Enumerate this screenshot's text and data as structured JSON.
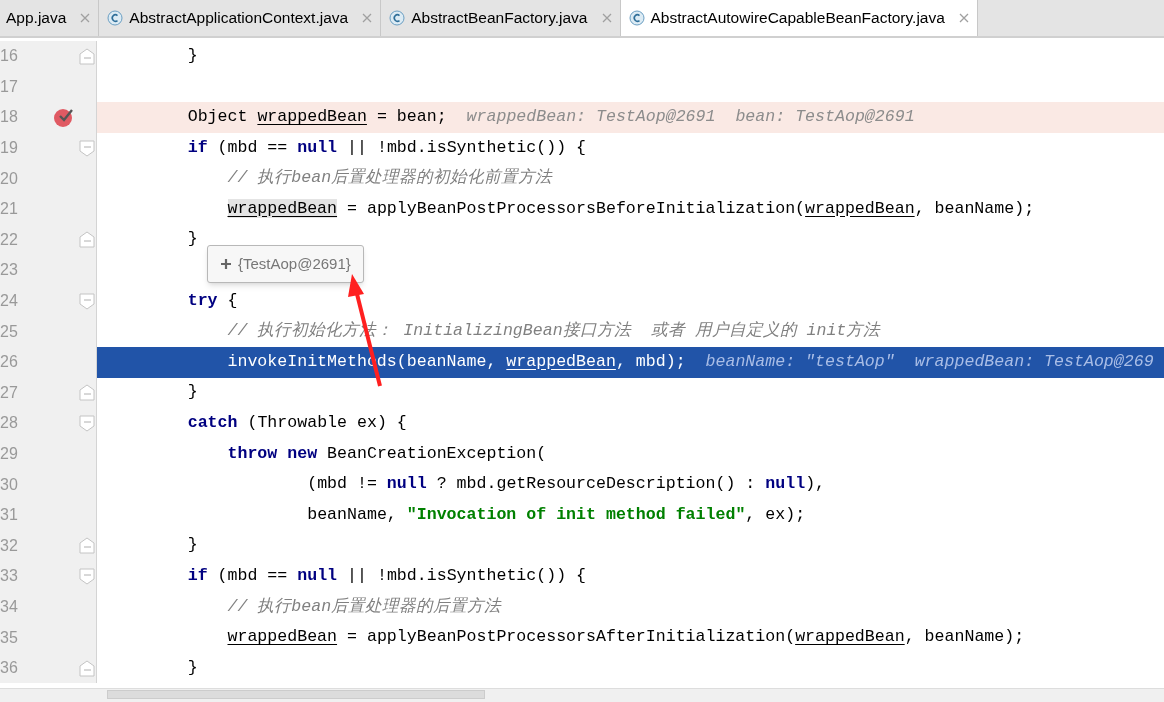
{
  "tabs": [
    {
      "label": "App.java",
      "icon": false,
      "selected": false
    },
    {
      "label": "AbstractApplicationContext.java",
      "icon": true,
      "selected": false
    },
    {
      "label": "AbstractBeanFactory.java",
      "icon": true,
      "selected": false
    },
    {
      "label": "AbstractAutowireCapableBeanFactory.java",
      "icon": true,
      "selected": true
    }
  ],
  "lines": [
    {
      "number": "16",
      "fold_end": true,
      "tokens": [
        {
          "kind": "plain",
          "text": "        }"
        }
      ]
    },
    {
      "number": "17"
    },
    {
      "number": "18",
      "breakpoint": true,
      "tokens": [
        {
          "kind": "plain",
          "text": "        Object "
        },
        {
          "kind": "var",
          "text": "wrappedBean"
        },
        {
          "kind": "plain",
          "text": " = bean;  "
        },
        {
          "kind": "hint",
          "text": "wrappedBean: TestAop@2691  bean: TestAop@2691"
        }
      ]
    },
    {
      "number": "19",
      "fold_start": true,
      "tokens": [
        {
          "kind": "kw",
          "text": "        if"
        },
        {
          "kind": "plain",
          "text": " (mbd == "
        },
        {
          "kind": "kw",
          "text": "null"
        },
        {
          "kind": "op",
          "text": " || "
        },
        {
          "kind": "plain",
          "text": "!mbd.isSynthetic()) {"
        }
      ]
    },
    {
      "number": "20",
      "tokens": [
        {
          "kind": "comment",
          "text": "            // 执行bean后置处理器的初始化前置方法"
        }
      ]
    },
    {
      "number": "21",
      "tokens": [
        {
          "kind": "var_selected",
          "text": "            wrappedBean"
        },
        {
          "kind": "plain",
          "text": " = applyBeanPostProcessorsBeforeInitialization("
        },
        {
          "kind": "var",
          "text": "wrappedBean"
        },
        {
          "kind": "plain",
          "text": ", beanName);"
        }
      ]
    },
    {
      "number": "22",
      "fold_end": true,
      "tokens": [
        {
          "kind": "plain",
          "text": "        }"
        }
      ]
    },
    {
      "number": "23"
    },
    {
      "number": "24",
      "fold_start": true,
      "tokens": [
        {
          "kind": "kw",
          "text": "        try"
        },
        {
          "kind": "plain",
          "text": " {"
        }
      ]
    },
    {
      "number": "25",
      "tokens": [
        {
          "kind": "comment",
          "text": "            // 执行初始化方法： InitializingBean接口方法  或者 用户自定义的 init方法"
        }
      ]
    },
    {
      "number": "26",
      "current": true,
      "tokens": [
        {
          "kind": "plain",
          "text": "            invokeInitMethods(beanName, "
        },
        {
          "kind": "var",
          "text": "wrappedBean"
        },
        {
          "kind": "plain",
          "text": ", mbd);  "
        },
        {
          "kind": "hint",
          "text": "beanName: \"testAop\"  wrappedBean: TestAop@269"
        }
      ]
    },
    {
      "number": "27",
      "fold_end": true,
      "tokens": [
        {
          "kind": "plain",
          "text": "        }"
        }
      ]
    },
    {
      "number": "28",
      "fold_start": true,
      "tokens": [
        {
          "kind": "kw",
          "text": "        catch"
        },
        {
          "kind": "plain",
          "text": " (Throwable ex) {"
        }
      ]
    },
    {
      "number": "29",
      "tokens": [
        {
          "kind": "kw",
          "text": "            throw new"
        },
        {
          "kind": "plain",
          "text": " BeanCreationException("
        }
      ]
    },
    {
      "number": "30",
      "tokens": [
        {
          "kind": "plain",
          "text": "                    (mbd != "
        },
        {
          "kind": "kw",
          "text": "null"
        },
        {
          "kind": "plain",
          "text": " ? mbd.getResourceDescription() : "
        },
        {
          "kind": "kw",
          "text": "null"
        },
        {
          "kind": "plain",
          "text": "),"
        }
      ]
    },
    {
      "number": "31",
      "tokens": [
        {
          "kind": "plain",
          "text": "                    beanName, "
        },
        {
          "kind": "str",
          "text": "\"Invocation of init method failed\""
        },
        {
          "kind": "plain",
          "text": ", ex);"
        }
      ]
    },
    {
      "number": "32",
      "fold_end": true,
      "tokens": [
        {
          "kind": "plain",
          "text": "        }"
        }
      ]
    },
    {
      "number": "33",
      "fold_start": true,
      "tokens": [
        {
          "kind": "kw",
          "text": "        if"
        },
        {
          "kind": "plain",
          "text": " (mbd == "
        },
        {
          "kind": "kw",
          "text": "null"
        },
        {
          "kind": "op",
          "text": " || "
        },
        {
          "kind": "plain",
          "text": "!mbd.isSynthetic()) {"
        }
      ]
    },
    {
      "number": "34",
      "tokens": [
        {
          "kind": "comment",
          "text": "            // 执行bean后置处理器的后置方法"
        }
      ]
    },
    {
      "number": "35",
      "tokens": [
        {
          "kind": "var",
          "text": "            wrappedBean"
        },
        {
          "kind": "plain",
          "text": " = applyBeanPostProcessorsAfterInitialization("
        },
        {
          "kind": "var",
          "text": "wrappedBean"
        },
        {
          "kind": "plain",
          "text": ", beanName);"
        }
      ]
    },
    {
      "number": "36",
      "fold_end": true,
      "tokens": [
        {
          "kind": "plain",
          "text": "        }"
        }
      ]
    }
  ],
  "popup": {
    "value": "{TestAop@2691}"
  }
}
